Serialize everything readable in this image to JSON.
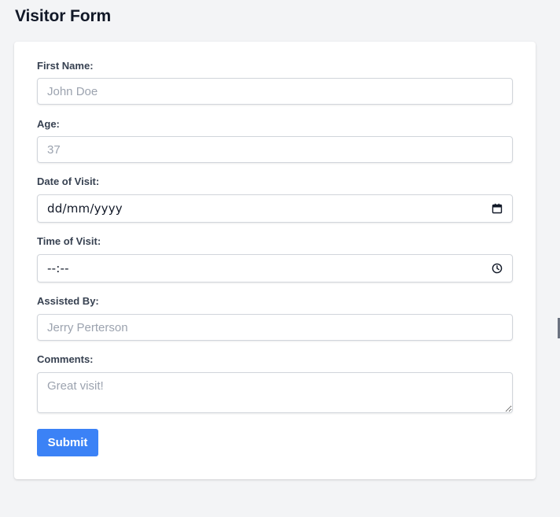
{
  "page": {
    "title": "Visitor Form"
  },
  "form": {
    "fields": {
      "first_name": {
        "label": "First Name:",
        "placeholder": "John Doe"
      },
      "age": {
        "label": "Age:",
        "placeholder": "37"
      },
      "date_of_visit": {
        "label": "Date of Visit:",
        "value": "dd/mm/yyyy",
        "icon": "calendar-icon"
      },
      "time_of_visit": {
        "label": "Time of Visit:",
        "value": "--:--",
        "icon": "clock-icon"
      },
      "assisted_by": {
        "label": "Assisted By:",
        "placeholder": "Jerry Perterson"
      },
      "comments": {
        "label": "Comments:",
        "placeholder": "Great visit!"
      }
    },
    "submit_label": "Submit"
  },
  "colors": {
    "background": "#f3f4f6",
    "card": "#ffffff",
    "accent": "#3b82f6",
    "label": "#374151",
    "placeholder": "#9ca3af"
  }
}
